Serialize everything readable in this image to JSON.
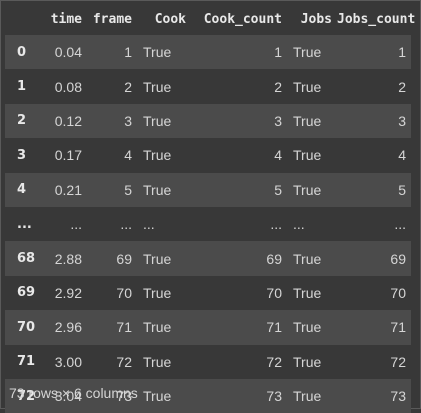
{
  "table": {
    "columns": [
      "",
      "time",
      "frame",
      "Cook",
      "Cook_count",
      "Jobs",
      "Jobs_count"
    ],
    "rows": [
      [
        "0",
        "0.04",
        "1",
        "True",
        "1",
        "True",
        "1"
      ],
      [
        "1",
        "0.08",
        "2",
        "True",
        "2",
        "True",
        "2"
      ],
      [
        "2",
        "0.12",
        "3",
        "True",
        "3",
        "True",
        "3"
      ],
      [
        "3",
        "0.17",
        "4",
        "True",
        "4",
        "True",
        "4"
      ],
      [
        "4",
        "0.21",
        "5",
        "True",
        "5",
        "True",
        "5"
      ],
      [
        "...",
        "...",
        "...",
        "...",
        "...",
        "...",
        "..."
      ],
      [
        "68",
        "2.88",
        "69",
        "True",
        "69",
        "True",
        "69"
      ],
      [
        "69",
        "2.92",
        "70",
        "True",
        "70",
        "True",
        "70"
      ],
      [
        "70",
        "2.96",
        "71",
        "True",
        "71",
        "True",
        "71"
      ],
      [
        "71",
        "3.00",
        "72",
        "True",
        "72",
        "True",
        "72"
      ],
      [
        "72",
        "3.04",
        "73",
        "True",
        "73",
        "True",
        "73"
      ]
    ]
  },
  "footer": "73 rows × 6 columns"
}
